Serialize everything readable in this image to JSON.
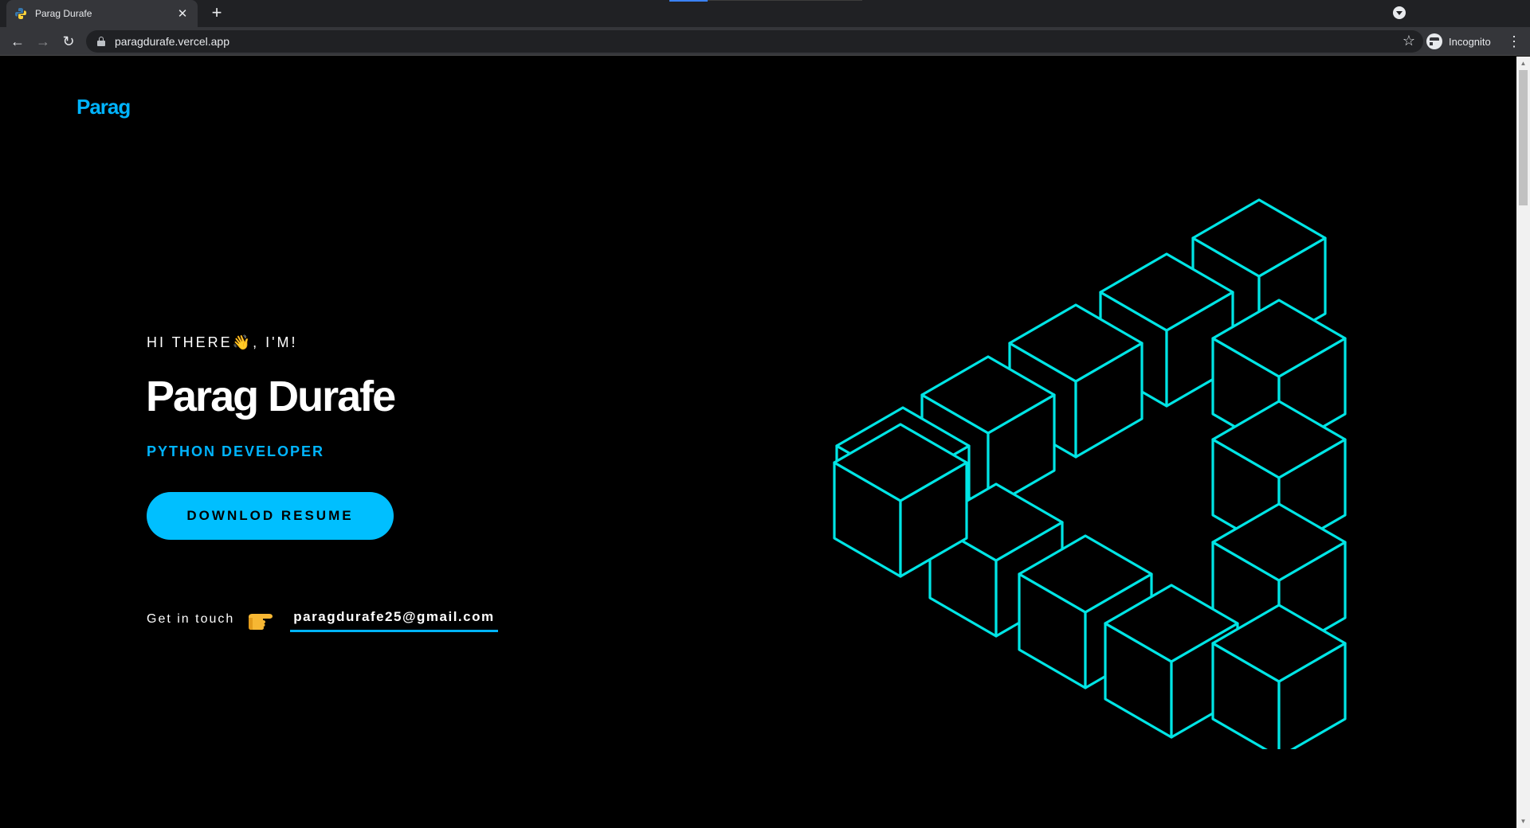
{
  "browser": {
    "tab_title": "Parag Durafe",
    "tab_close": "✕",
    "new_tab": "+",
    "url": "paragdurafe.vercel.app",
    "profile_label": "Incognito",
    "back": "←",
    "forward": "→",
    "reload": "↻",
    "star": "☆",
    "menu": "⋮"
  },
  "hero": {
    "logo": "Parag",
    "greeting": "HI THERE👋, I'M!",
    "name": "Parag Durafe",
    "role": "PYTHON DEVELOPER",
    "resume_button": "DOWNLOD RESUME",
    "touch_label": "Get in touch",
    "email": "paragdurafe25@gmail.com"
  },
  "colors": {
    "accent": "#00b4ff",
    "button": "#00bfff",
    "cube_stroke": "#00e5e5",
    "background": "#000000"
  },
  "icons": {
    "favicon": "python-icon",
    "hand": "pointing-hand-icon",
    "art": "impossible-triangle-cubes"
  }
}
